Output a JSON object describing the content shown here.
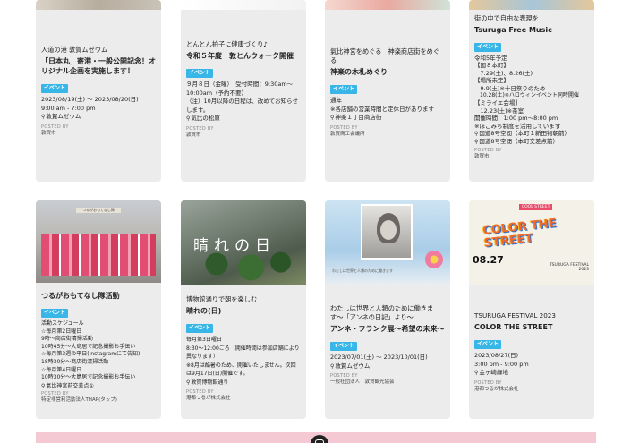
{
  "cards_row1": [
    {
      "sub": "人道の港 敦賀ムゼウム",
      "title": "「日本丸」寄港・一般公開記念！オリジナル企画を実施します！",
      "badge": "イベント",
      "lines": [
        "2023/08/19(土) 〜 2023/08/20(日)",
        "9:00 am - 7:00 pm"
      ],
      "location": "敦賀ムゼウム",
      "posted_label": "POSTED BY",
      "posted_by": "敦賀市"
    },
    {
      "sub": "とんとん拍子に健康づくり♪",
      "title": "令和５年度　敦とんウォーク開催",
      "badge": "イベント",
      "lines": [
        "９月８日（金曜）　受付時間：9:30am〜",
        "10:00am（予約不要）",
        "（注）10月以降の日程は、改めてお知らせします。"
      ],
      "location": "気比の松原",
      "posted_label": "POSTED BY",
      "posted_by": "敦賀市"
    },
    {
      "sub": "氣比神宮をめぐる　神楽商店街をめぐる",
      "title": "神楽の木札めぐり",
      "badge": "イベント",
      "lines": [
        "通年",
        "※各店舗の営業時間と定休日があります"
      ],
      "location": "神楽１丁目商店街",
      "posted_label": "POSTED BY",
      "posted_by": "敦賀商工会議所"
    },
    {
      "sub": "街の中で自由な表現を",
      "title": "Tsuruga Free Music",
      "badge": "イベント",
      "lines": [
        "令和5年予定",
        "【国８本町】",
        "　7.29(土)、8.26(土)",
        "【場所未定】",
        "　9.9(土)※十日祭りのため",
        "　10.28(土)※ハロウィンイベント同時開催",
        "【ミライエ会場】",
        "　12.23(土)※茶室",
        "開催時間：1:00 pm〜8:00 pm",
        "※ほこみち制度を活用しています"
      ],
      "locations": [
        "国道8号空間（本町１新田物朝前）",
        "国道8号空間（本町交差点前）"
      ],
      "posted_label": "POSTED BY",
      "posted_by": "敦賀市"
    }
  ],
  "cards_row2": [
    {
      "photo_sign": "つるがおもてなし隊",
      "title": "つるがおもてなし隊活動",
      "badge": "イベント",
      "lines": [
        "活動スケジュール",
        "☆毎月第2日曜日",
        "9時〜商店街清掃活動",
        "10時45分〜大島居で記念撮影お手伝い",
        "☆毎月第3週の平日(Instagramにて告知)",
        "18時30分〜商店街清掃活動",
        "☆毎月第4日曜日",
        "10時30分〜大島居で記念撮影お手伝い"
      ],
      "location": "氣比神宮前交差点①",
      "posted_label": "POSTED BY",
      "posted_by": "特定非営利活動法人THAP(タップ)"
    },
    {
      "photo_text": "晴れの日",
      "sub": "博物館通りで朝を楽しむ",
      "title": "晴れの(日)",
      "badge": "イベント",
      "lines": [
        "毎月第3日曜日",
        "8:30〜12:00ごろ（開催時間は参加店舗により異なります）",
        "※8月は酷暑のため、開催いたしません。次回は9月17日(日)開催です。"
      ],
      "location": "敦賀博物館通り",
      "posted_label": "POSTED BY",
      "posted_by": "港都つるが株式会社"
    },
    {
      "photo_caption": "わたしは世界と人類のために働きます",
      "sub": "わたしは世界と人類のために働きます〜「アンネの日記」より〜",
      "title": "アンネ・フランク展〜希望の未来〜",
      "badge": "イベント",
      "lines": [
        "2023/07/01(土) 〜 2023/10/01(日)"
      ],
      "location": "敦賀ムゼウム",
      "posted_label": "POSTED BY",
      "posted_by": "一般社団法人　敦賀観光協会"
    },
    {
      "poster_street": "COOL STREET",
      "poster_text": "COLOR THE STREET",
      "poster_date": "08.27",
      "poster_year": "TSURUGA FESTIVAL 2023",
      "sub": "TSURUGA FESTIVAL 2023",
      "title": "COLOR THE STREET",
      "badge": "イベント",
      "lines": [
        "2023/08/27(日)",
        "3:00 pm - 9:00 pm"
      ],
      "location": "金ヶ崎緑地",
      "posted_label": "POSTED BY",
      "posted_by": "港都つるが株式会社"
    }
  ],
  "footer": {
    "icon": "instagram-icon",
    "bar_color": "#f5c9d3"
  },
  "colors": {
    "badge": "#38b6e8",
    "card_bg": "#ececec"
  }
}
